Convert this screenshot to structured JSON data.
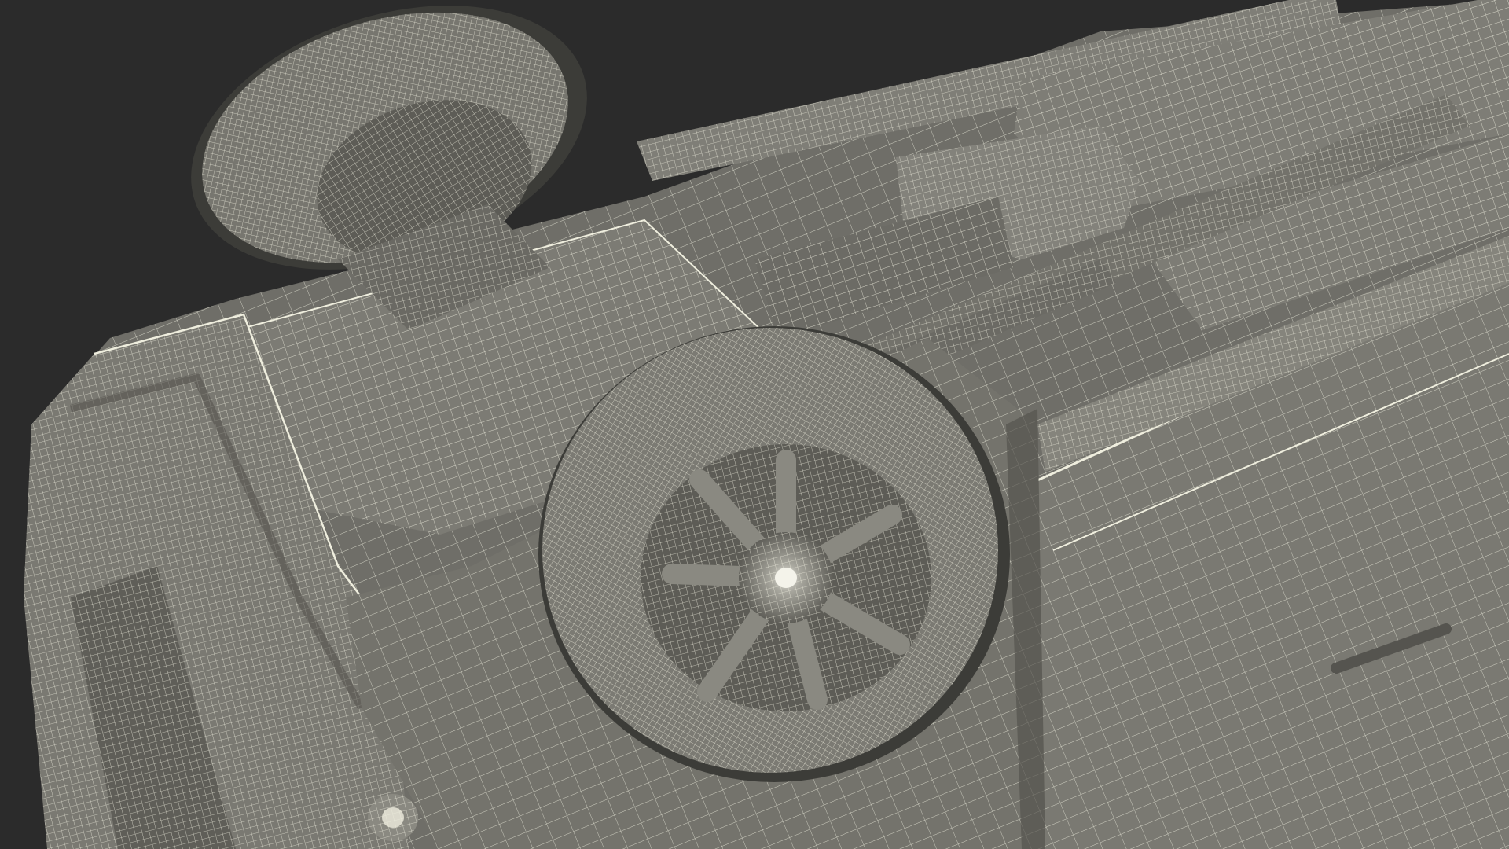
{
  "image": {
    "subject": "car-underside-wireframe-render",
    "colors": {
      "background": "#2b2b2b",
      "surface": "#6f6e68",
      "surface_light": "#85847c",
      "surface_dark": "#55544f",
      "wire": "#efeede",
      "tire": "#74736c",
      "shadow": "#3c3c38"
    }
  }
}
